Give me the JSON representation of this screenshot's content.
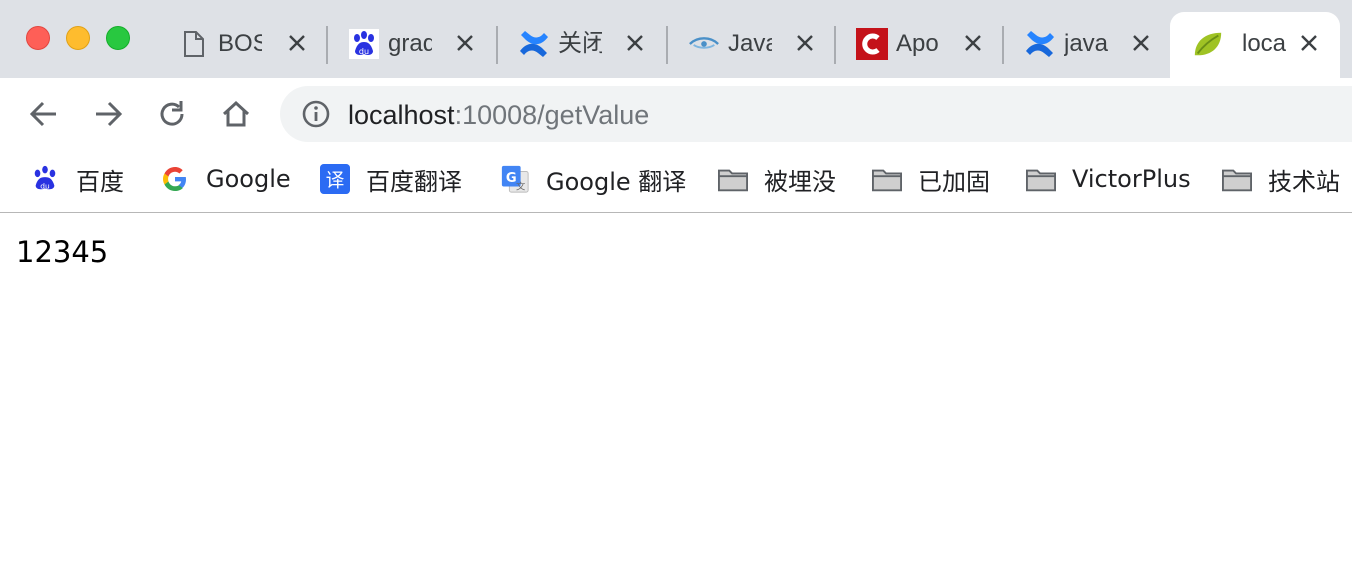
{
  "window": {
    "colors": {
      "tabstrip_bg": "#dee1e6",
      "close": "#fe5f57",
      "minimize": "#febc2e",
      "maximize": "#28c840"
    }
  },
  "tabs": [
    {
      "title": "BOS",
      "icon": "document-icon"
    },
    {
      "title": "grad",
      "icon": "baidu-paw-icon"
    },
    {
      "title": "关闭",
      "icon": "confluence-icon"
    },
    {
      "title": "Java",
      "icon": "eye-logo-icon"
    },
    {
      "title": "Apo",
      "icon": "red-c-icon"
    },
    {
      "title": "java",
      "icon": "confluence-icon"
    },
    {
      "title": "loca",
      "icon": "spring-leaf-icon",
      "active": true
    }
  ],
  "toolbar": {
    "url_host": "localhost",
    "url_path": ":10008/getValue"
  },
  "bookmarks": [
    {
      "label": "百度",
      "icon": "baidu-paw-icon"
    },
    {
      "label": "Google",
      "icon": "google-g-icon"
    },
    {
      "label": "百度翻译",
      "icon": "translate-icon"
    },
    {
      "label": "Google 翻译",
      "icon": "google-translate-icon"
    },
    {
      "label": "被埋没",
      "icon": "folder-icon"
    },
    {
      "label": "已加固",
      "icon": "folder-icon"
    },
    {
      "label": "VictorPlus",
      "icon": "folder-icon"
    },
    {
      "label": "技术站",
      "icon": "folder-icon"
    }
  ],
  "page": {
    "body_text": "12345"
  }
}
